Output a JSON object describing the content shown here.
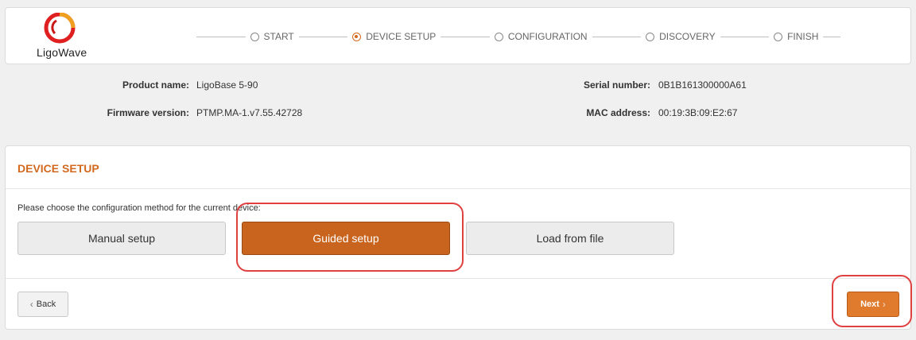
{
  "header": {
    "logo_text": "LigoWave",
    "steps": [
      {
        "label": "START",
        "active": false
      },
      {
        "label": "DEVICE SETUP",
        "active": true
      },
      {
        "label": "CONFIGURATION",
        "active": false
      },
      {
        "label": "DISCOVERY",
        "active": false
      },
      {
        "label": "FINISH",
        "active": false
      }
    ]
  },
  "device_info": {
    "product_name_label": "Product name:",
    "product_name": "LigoBase 5-90",
    "firmware_label": "Firmware version:",
    "firmware": "PTMP.MA-1.v7.55.42728",
    "serial_label": "Serial number:",
    "serial": "0B1B161300000A61",
    "mac_label": "MAC address:",
    "mac": "00:19:3B:09:E2:67"
  },
  "panel": {
    "title": "DEVICE SETUP",
    "prompt": "Please choose the configuration method for the current device:",
    "methods": [
      {
        "label": "Manual setup",
        "selected": false
      },
      {
        "label": "Guided setup",
        "selected": true
      },
      {
        "label": "Load from file",
        "selected": false
      }
    ],
    "back_label": "Back",
    "next_label": "Next"
  },
  "colors": {
    "accent": "#d2691e",
    "selected_button": "#c8641e",
    "next_button": "#e07a2c",
    "highlight": "#e04040"
  }
}
